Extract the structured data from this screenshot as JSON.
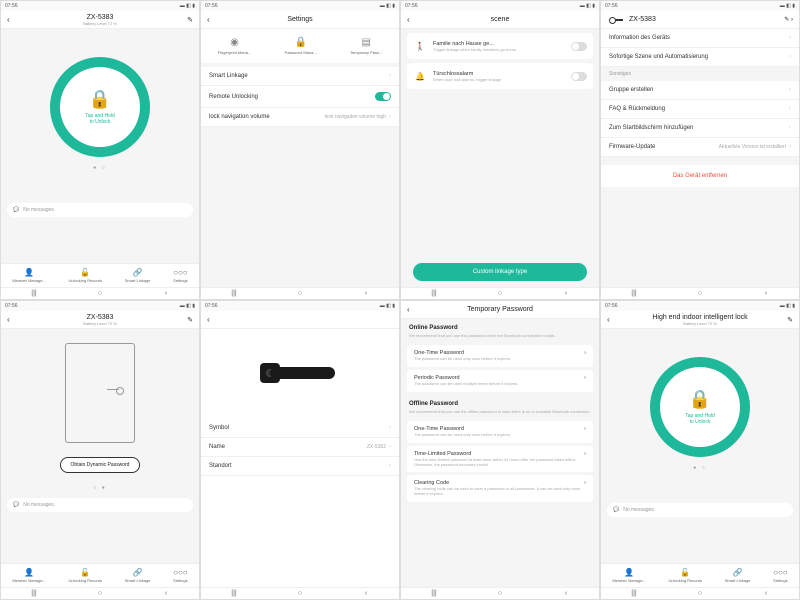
{
  "status": {
    "time": "07:56",
    "icons": "▬ ◧ ▮"
  },
  "nav": {
    "recent": "|||",
    "home": "○",
    "back": "‹"
  },
  "tabs": {
    "member": {
      "icon": "👤",
      "label": "Member Manage..."
    },
    "records": {
      "icon": "🔓",
      "label": "Unlocking Records"
    },
    "linkage": {
      "icon": "🔗",
      "label": "Smart Linkage"
    },
    "settings": {
      "icon": "○○○",
      "label": "Settings"
    }
  },
  "s1": {
    "title": "ZX-5383",
    "battery": "Battery Level 72 %",
    "unlock": "Tap and Hold\nto Unlock",
    "msg_icon": "💬",
    "msg": "No messages."
  },
  "s2": {
    "title": "Settings",
    "icons": {
      "fp": {
        "ic": "◉",
        "label": "Fingerprint Mana..."
      },
      "pw": {
        "ic": "🔒",
        "label": "Password Mana..."
      },
      "tmp": {
        "ic": "▤",
        "label": "Temporary Pass..."
      }
    },
    "r1": "Smart Linkage",
    "r2": "Remote Unlocking",
    "r3": "lock navigation volume",
    "r3v": "lock navigation volume high"
  },
  "s3": {
    "title": "scene",
    "r1": {
      "ic": "🚶",
      "t": "Familie nach Hause ge...",
      "s": "Trigger linkage when family members go home"
    },
    "r2": {
      "ic": "🔔",
      "t": "Türschlossalarm",
      "s": "When door lock alarms, trigger linkage"
    },
    "btn": "Custom linkage type"
  },
  "s4": {
    "title": "ZX-5383",
    "r1": "Information des Geräts",
    "r2": "Sofortige Szene und Automatisierung",
    "sec": "Sonstiges",
    "r3": "Gruppe erstellen",
    "r4": "FAQ & Rückmeldung",
    "r5": "Zum Startbildschirm hinzufügen",
    "r6": "Firmware-Update",
    "r6v": "Aktuellste Version ist installiert",
    "danger": "Das Gerät entfernen"
  },
  "s5": {
    "title": "ZX-5383",
    "battery": "Battery Level 72 %",
    "btn": "Obtain Dynamic Password",
    "msg": "No messages."
  },
  "s6": {
    "r1": "Symbol",
    "r2": "Name",
    "r2v": "ZX-5382",
    "r3": "Standort"
  },
  "s7": {
    "title": "Temporary Password",
    "online_hdr": "Online Password",
    "online_desc": "We recommend that you use this password when the Bluetooth connection is stab...",
    "c1": {
      "t": "One-Time Password",
      "d": "The password can be used only once before it expires."
    },
    "c2": {
      "t": "Periodic Password",
      "d": "The password can be used multiple times before it expires."
    },
    "offline_hdr": "Offline Password",
    "offline_desc": "We recommend that you use the offline password in case there is no or unstable Bluetooth connection.",
    "c3": {
      "t": "One-Time Password",
      "d": "The password can be used only once before it expires."
    },
    "c4": {
      "t": "Time-Limited Password",
      "d": "Use the time-limited password at least once within 24 hours after the password takes effect. Otherwise, the password becomes invalid."
    },
    "c5": {
      "t": "Clearing Code",
      "d": "The clearing code can be used to clear a password or all passwords. It can be used only once before it expires."
    }
  },
  "s8": {
    "title": "High end indoor intelligent lock",
    "battery": "Battery Level 72 %",
    "unlock": "Tap and Hold\nto Unlock",
    "msg": "No messages."
  }
}
